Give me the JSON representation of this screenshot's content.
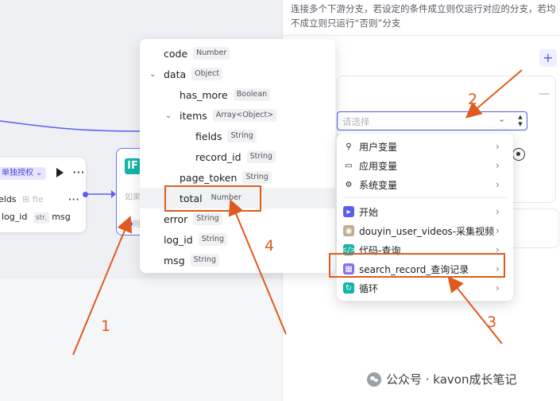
{
  "panel": {
    "description": "连接多个下游分支，若设定的条件成立则仅运行对应的分支，若均不成立则只运行“否则”分支",
    "section_title": "",
    "add_label": "+",
    "select_placeholder": "请选择"
  },
  "left_node": {
    "auth_tag": "单独授权",
    "fields_label": "elds",
    "fields_faded": "fie",
    "log_id_label": "log_id",
    "str_tag": "str.",
    "msg_label": "msg"
  },
  "if_node": {
    "badge": "IF",
    "faded_1": "如果",
    "faded_2": "否则"
  },
  "var_tree": [
    {
      "name": "code",
      "type": "Number",
      "indent": 0,
      "caret": ""
    },
    {
      "name": "data",
      "type": "Object",
      "indent": 0,
      "caret": "⌄"
    },
    {
      "name": "has_more",
      "type": "Boolean",
      "indent": 1,
      "caret": ""
    },
    {
      "name": "items",
      "type": "Array<Object>",
      "indent": 1,
      "caret": "⌄"
    },
    {
      "name": "fields",
      "type": "String",
      "indent": 2,
      "caret": ""
    },
    {
      "name": "record_id",
      "type": "String",
      "indent": 2,
      "caret": ""
    },
    {
      "name": "page_token",
      "type": "String",
      "indent": 1,
      "caret": ""
    },
    {
      "name": "total",
      "type": "Number",
      "indent": 1,
      "caret": "",
      "highlight": true
    },
    {
      "name": "error",
      "type": "String",
      "indent": 0,
      "caret": ""
    },
    {
      "name": "log_id",
      "type": "String",
      "indent": 0,
      "caret": ""
    },
    {
      "name": "msg",
      "type": "String",
      "indent": 0,
      "caret": ""
    }
  ],
  "src_menu": [
    {
      "label": "用户变量",
      "icon": "user-icon",
      "glyph": "⚲"
    },
    {
      "label": "应用变量",
      "icon": "folder-icon",
      "glyph": "▭"
    },
    {
      "label": "系统变量",
      "icon": "gear-icon",
      "glyph": "⚙"
    },
    {
      "label": "开始",
      "icon": "start-icon",
      "glyph": "▸",
      "color": "#5b5ff0"
    },
    {
      "label": "douyin_user_videos-采集视频",
      "icon": "plugin-avatar-icon",
      "glyph": "◉",
      "color": "#bfae8e"
    },
    {
      "label": "代码-查询",
      "icon": "code-icon",
      "glyph": "</>",
      "color": "#12b5a6"
    },
    {
      "label": "search_record_查询记录",
      "icon": "database-icon",
      "glyph": "▦",
      "color": "#8a6cf0"
    },
    {
      "label": "循环",
      "icon": "loop-icon",
      "glyph": "↻",
      "color": "#12b5a6"
    }
  ],
  "annotations": [
    "1",
    "2",
    "3",
    "4"
  ],
  "watermark": "公众号 · kavon成长笔记",
  "colors": {
    "accent": "#4c55e8",
    "annotation": "#e05a1d",
    "if_badge": "#12b5a6"
  }
}
